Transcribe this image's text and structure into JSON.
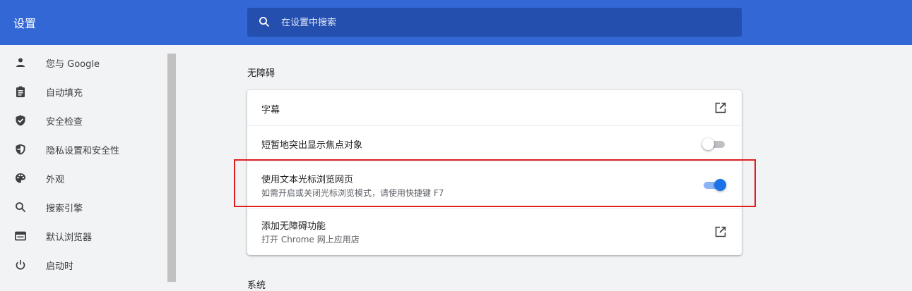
{
  "header": {
    "title": "设置",
    "search_placeholder": "在设置中搜索",
    "search_icon": "search-icon"
  },
  "sidebar": {
    "items": [
      {
        "label": "您与 Google",
        "icon": "person-icon"
      },
      {
        "label": "自动填充",
        "icon": "clipboard-icon"
      },
      {
        "label": "安全检查",
        "icon": "shield-check-icon"
      },
      {
        "label": "隐私设置和安全性",
        "icon": "privacy-shield-icon"
      },
      {
        "label": "外观",
        "icon": "palette-icon"
      },
      {
        "label": "搜索引擎",
        "icon": "search-icon"
      },
      {
        "label": "默认浏览器",
        "icon": "browser-window-icon"
      },
      {
        "label": "启动时",
        "icon": "power-icon"
      }
    ]
  },
  "main": {
    "section_title": "无障碍",
    "rows": [
      {
        "label": "字幕",
        "control": "external-link-icon"
      },
      {
        "label": "短暂地突出显示焦点对象",
        "control": "toggle",
        "value": "off"
      },
      {
        "label": "使用文本光标浏览网页",
        "secondary": "如需开启或关闭光标浏览模式，请使用快捷键 F7",
        "control": "toggle",
        "value": "on"
      },
      {
        "label": "添加无障碍功能",
        "secondary": "打开 Chrome 网上应用店",
        "control": "external-link-icon"
      }
    ],
    "next_section_title": "系统"
  },
  "colors": {
    "header": "#3367d6",
    "search_bg": "#254fae",
    "toggle_on": "#1a73e8",
    "highlight": "#e02020"
  }
}
